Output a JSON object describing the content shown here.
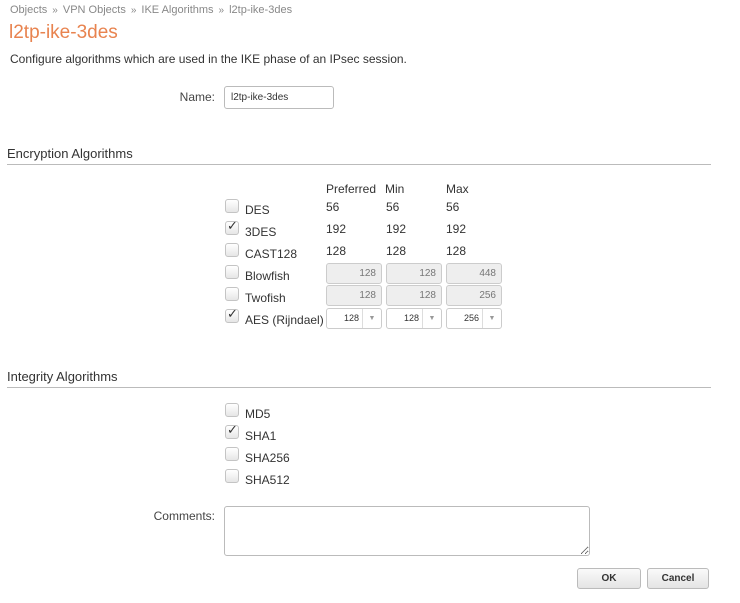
{
  "breadcrumb": [
    "Objects",
    "VPN Objects",
    "IKE Algorithms",
    "l2tp-ike-3des"
  ],
  "title": "l2tp-ike-3des",
  "description": "Configure algorithms which are used in the IKE phase of an IPsec session.",
  "name": {
    "label": "Name:",
    "value": "l2tp-ike-3des"
  },
  "encryption": {
    "heading": "Encryption Algorithms",
    "columns": [
      "Preferred",
      "Min",
      "Max"
    ],
    "rows": [
      {
        "label": "DES",
        "checked": false,
        "type": "text",
        "values": [
          "56",
          "56",
          "56"
        ]
      },
      {
        "label": "3DES",
        "checked": true,
        "type": "text",
        "values": [
          "192",
          "192",
          "192"
        ]
      },
      {
        "label": "CAST128",
        "checked": false,
        "type": "text",
        "values": [
          "128",
          "128",
          "128"
        ]
      },
      {
        "label": "Blowfish",
        "checked": false,
        "type": "disabled",
        "values": [
          "128",
          "128",
          "448"
        ]
      },
      {
        "label": "Twofish",
        "checked": false,
        "type": "disabled",
        "values": [
          "128",
          "128",
          "256"
        ]
      },
      {
        "label": "AES (Rijndael)",
        "checked": true,
        "type": "select",
        "values": [
          "128",
          "128",
          "256"
        ]
      }
    ]
  },
  "integrity": {
    "heading": "Integrity Algorithms",
    "rows": [
      {
        "label": "MD5",
        "checked": false
      },
      {
        "label": "SHA1",
        "checked": true
      },
      {
        "label": "SHA256",
        "checked": false
      },
      {
        "label": "SHA512",
        "checked": false
      }
    ]
  },
  "comments": {
    "label": "Comments:",
    "value": ""
  },
  "buttons": {
    "ok": "OK",
    "cancel": "Cancel"
  },
  "check_mark": "✓",
  "dropdown_arrow": "▼"
}
